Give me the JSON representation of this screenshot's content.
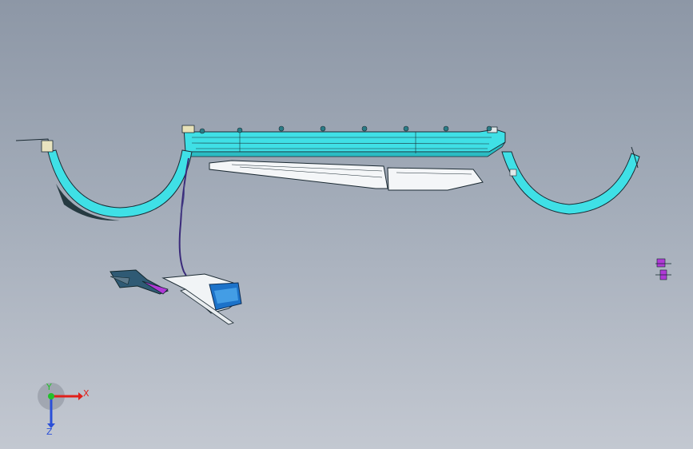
{
  "viewport": {
    "name": "cad-3d-viewport",
    "background_top": "#8d97a6",
    "background_bottom": "#c3c8d1"
  },
  "model": {
    "primary_color": "#3fe0e6",
    "edge_color": "#1b2a33",
    "accent_purple": "#b03ad6",
    "accent_blue": "#1c72c9",
    "parts": [
      "bumper-beam",
      "left-wheel-arch",
      "right-wheel-arch",
      "grille-panel",
      "wiring-harness",
      "lamp-bracket",
      "headlamp-assembly",
      "small-clip-part"
    ]
  },
  "triad": {
    "x_label": "X",
    "y_label": "Y",
    "z_label": "Z",
    "x_color": "#e0201b",
    "y_color": "#22c02a",
    "z_color": "#2a4fd8"
  }
}
